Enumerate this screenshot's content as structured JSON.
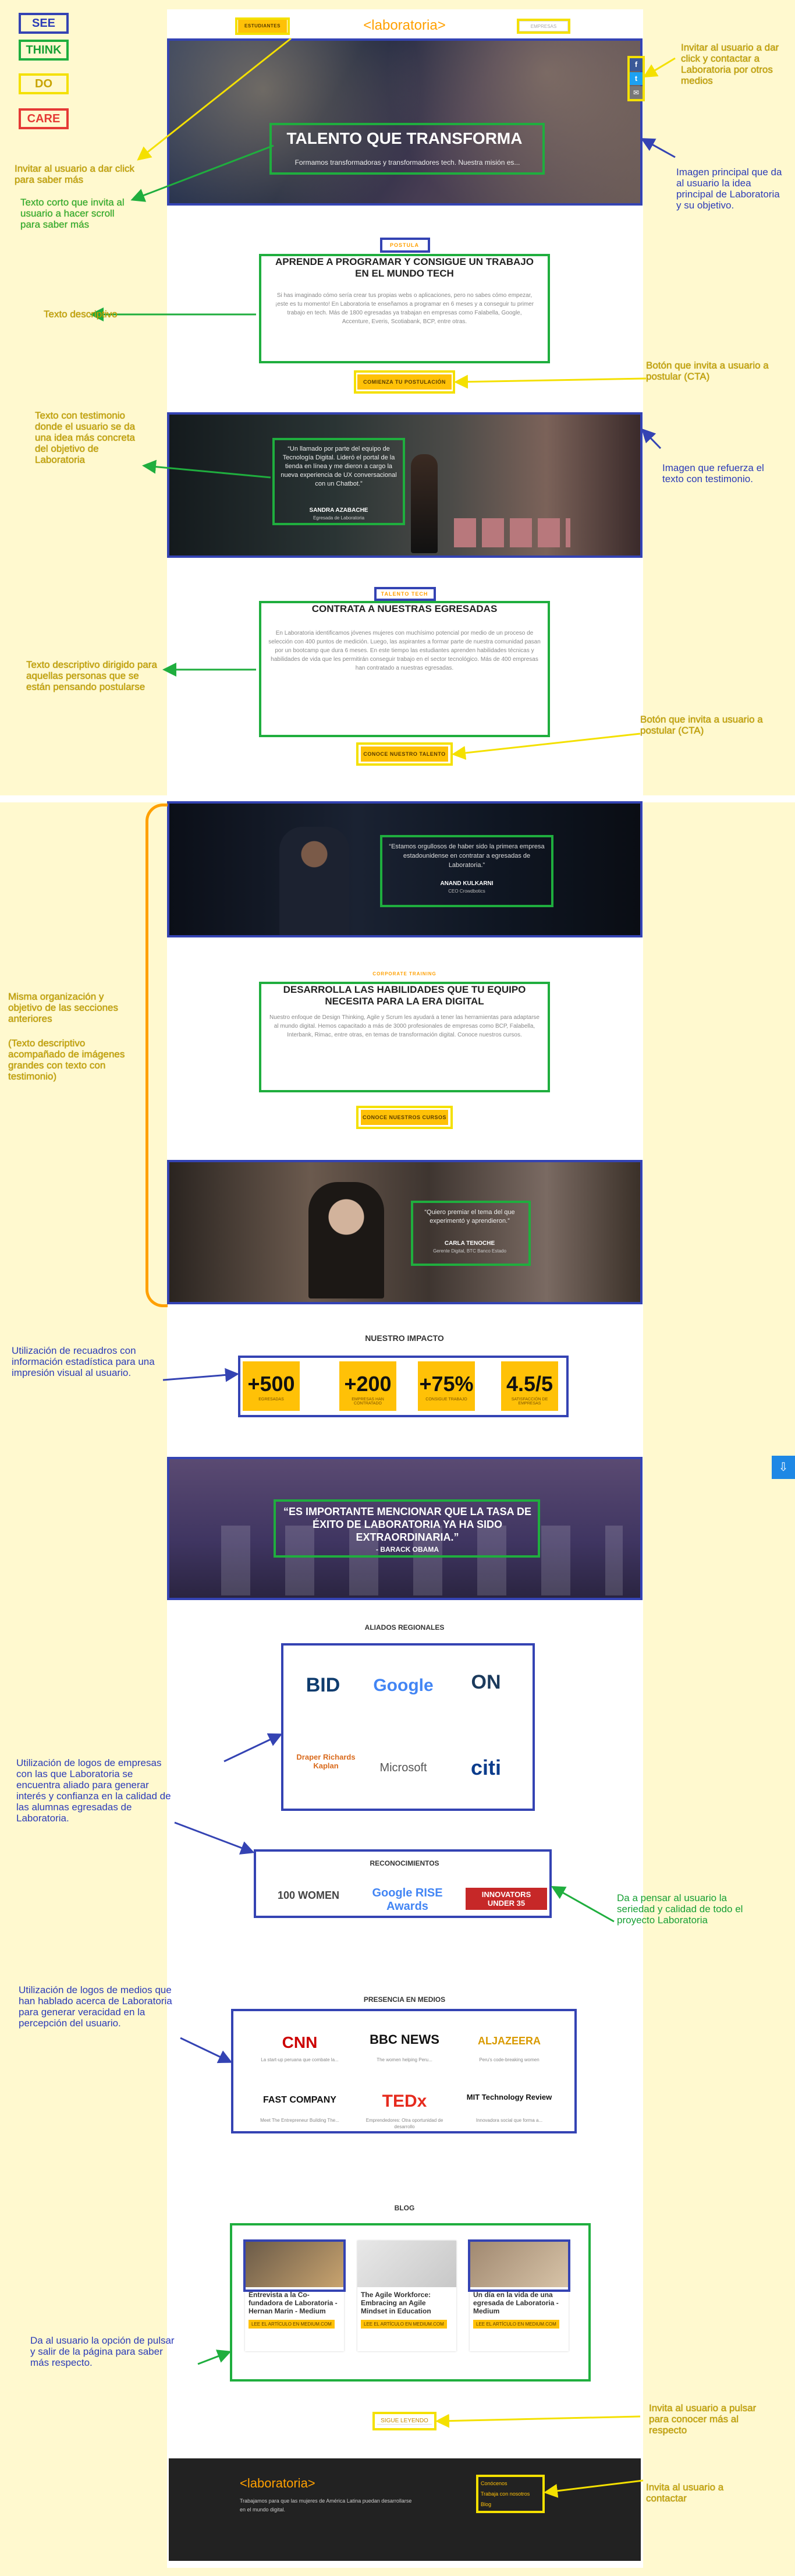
{
  "legend": {
    "see": "SEE",
    "think": "THINK",
    "do": "DO",
    "care": "CARE"
  },
  "nav": {
    "left_btn": "ESTUDIANTES",
    "logo": "<laboratoria>",
    "right_btn": "EMPRESAS"
  },
  "hero": {
    "title": "TALENTO QUE TRANSFORMA",
    "subtitle": "Formamos transformadoras y transformadores tech. Nuestra misión es...",
    "share": [
      "f",
      "t",
      "✉"
    ]
  },
  "s1": {
    "kicker": "POSTULA",
    "title": "APRENDE A PROGRAMAR Y CONSIGUE UN TRABAJO EN EL MUNDO TECH",
    "text": "Si has imaginado cómo sería crear tus propias webs o aplicaciones, pero no sabes cómo empezar, ¡este es tu momento! En Laboratoria te enseñamos a programar en 6 meses y a conseguir tu primer trabajo en tech. Más de 1800 egresadas ya trabajan en empresas como Falabella, Google, Accenture, Everis, Scotiabank, BCP, entre otras.",
    "cta": "COMIENZA TU POSTULACIÓN"
  },
  "t1": {
    "quote": "“Un llamado por parte del equipo de Tecnología Digital. Lideró el portal de la tienda en línea y me dieron a cargo la nueva experiencia de UX conversacional con un Chatbot.”",
    "name": "SANDRA AZABACHE",
    "role": "Egresada de Laboratoria"
  },
  "s2": {
    "kicker": "TALENTO TECH",
    "title": "CONTRATA A NUESTRAS EGRESADAS",
    "text": "En Laboratoria identificamos jóvenes mujeres con muchísimo potencial por medio de un proceso de selección con 400 puntos de medición. Luego, las aspirantes a formar parte de nuestra comunidad pasan por un bootcamp que dura 6 meses. En este tiempo las estudiantes aprenden habilidades técnicas y habilidades de vida que les permitirán conseguir trabajo en el sector tecnológico. Más de 400 empresas han contratado a nuestras egresadas.",
    "cta": "CONOCE NUESTRO TALENTO"
  },
  "t2": {
    "quote": "“Estamos orgullosos de haber sido la primera empresa estadounidense en contratar a egresadas de Laboratoria.”",
    "name": "ANAND KULKARNI",
    "role": "CEO Crowdbotics"
  },
  "s3": {
    "kicker": "CORPORATE TRAINING",
    "title": "DESARROLLA LAS HABILIDADES QUE TU EQUIPO NECESITA PARA LA ERA DIGITAL",
    "text": "Nuestro enfoque de Design Thinking, Agile y Scrum les ayudará a tener las herramientas para adaptarse al mundo digital. Hemos capacitado a más de 3000 profesionales de empresas como BCP, Falabella, Interbank, Rimac, entre otras, en temas de transformación digital. Conoce nuestros cursos.",
    "cta": "CONOCE NUESTROS CURSOS"
  },
  "t3": {
    "quote": "“Quiero premiar el tema del que experimentó y aprendieron.”",
    "name": "CARLA TENOCHE",
    "role": "Gerente Digital, BTC Banco Estado"
  },
  "impact": {
    "title": "NUESTRO IMPACTO",
    "stats": [
      {
        "n": "+500",
        "l": "EGRESADAS"
      },
      {
        "n": "+200",
        "l": "EMPRESAS HAN CONTRATADO"
      },
      {
        "n": "+75%",
        "l": "CONSIGUE TRABAJO"
      },
      {
        "n": "4.5/5",
        "l": "SATISFACCIÓN DE EMPRESAS"
      }
    ]
  },
  "obama": {
    "quote": "“ES IMPORTANTE MENCIONAR QUE LA TASA DE ÉXITO DE LABORATORIA YA HA SIDO EXTRAORDINARIA.”",
    "name": "- BARACK OBAMA"
  },
  "allies": {
    "title": "ALIADOS REGIONALES",
    "logos": [
      "BID",
      "Google",
      "ON",
      "Draper Richards Kaplan",
      "Microsoft",
      "citi"
    ]
  },
  "awards": {
    "title": "RECONOCIMIENTOS",
    "logos": [
      "100 WOMEN",
      "Google RISE Awards",
      "INNOVATORS UNDER 35"
    ]
  },
  "media": {
    "title": "PRESENCIA EN MEDIOS",
    "logos": [
      {
        "n": "CNN",
        "c": "La start-up peruana que combate la..."
      },
      {
        "n": "BBC NEWS",
        "c": "The women helping Peru..."
      },
      {
        "n": "ALJAZEERA",
        "c": "Peru's code-breaking women"
      },
      {
        "n": "FAST COMPANY",
        "c": "Meet The Entrepreneur Building The..."
      },
      {
        "n": "TEDx",
        "c": "Emprendedores: Otra oportunidad de desarrollo"
      },
      {
        "n": "MIT Technology Review",
        "c": "Innovadora social que forma a..."
      }
    ]
  },
  "blog": {
    "title": "BLOG",
    "posts": [
      {
        "t": "Entrevista a la Co-fundadora de Laboratoria - Hernan Marin - Medium",
        "l": "LEE EL ARTÍCULO EN MEDIUM.COM"
      },
      {
        "t": "The Agile Workforce: Embracing an Agile Mindset in Education",
        "l": "LEE EL ARTÍCULO EN MEDIUM.COM"
      },
      {
        "t": "Un día en la vida de una egresada de Laboratoria - Medium",
        "l": "LEE EL ARTÍCULO EN MEDIUM.COM"
      }
    ],
    "more": "SIGUE LEYENDO"
  },
  "footer": {
    "logo": "<laboratoria>",
    "text": "Trabajamos para que las mujeres de América Latina puedan desarrollarse en el mundo digital.",
    "links": [
      "Conócenos",
      "Trabaja con nosotros",
      "Blog"
    ]
  },
  "annotations": {
    "a1": "Invitar al usuario a dar click para saber más",
    "a2": "Texto corto que invita al usuario a hacer scroll para saber más",
    "a3": "Invitar al usuario a dar click y contactar a Laboratoria por otros medios",
    "a4": "Imagen principal que da al usuario la idea principal de Laboratoria y su objetivo.",
    "a5": "Texto descriptivo",
    "a6": "Botón que invita a usuario a postular (CTA)",
    "a7": "Texto con testimonio donde el usuario se da una idea más concreta del objetivo de Laboratoria",
    "a8": "Imagen que refuerza el texto con testimonio.",
    "a9": "Texto descriptivo dirigido para aquellas personas que se están pensando postularse",
    "a10": "Botón que invita a usuario a postular (CTA)",
    "a11": "Misma organización y objetivo de las secciones anteriores",
    "a12": "(Texto descriptivo acompañado de imágenes grandes con texto con testimonio)",
    "a13": "Utilización de recuadros con información estadística para una impresión visual al usuario.",
    "a14": "Utilización de logos de empresas con las que Laboratoria se encuentra aliado para generar interés y confianza en la calidad de las alumnas egresadas de Laboratoria.",
    "a15": "Da a pensar al usuario la seriedad y calidad de todo el proyecto Laboratoria",
    "a16": "Utilización de logos de medios que han hablado acerca de Laboratoria para generar veracidad en la percepción del usuario.",
    "a17": "Da al usuario la opción de pulsar y salir de la página para saber más respecto.",
    "a18": "Invita al usuario a pulsar para conocer más al respecto",
    "a19": "Invita al usuario a contactar"
  }
}
